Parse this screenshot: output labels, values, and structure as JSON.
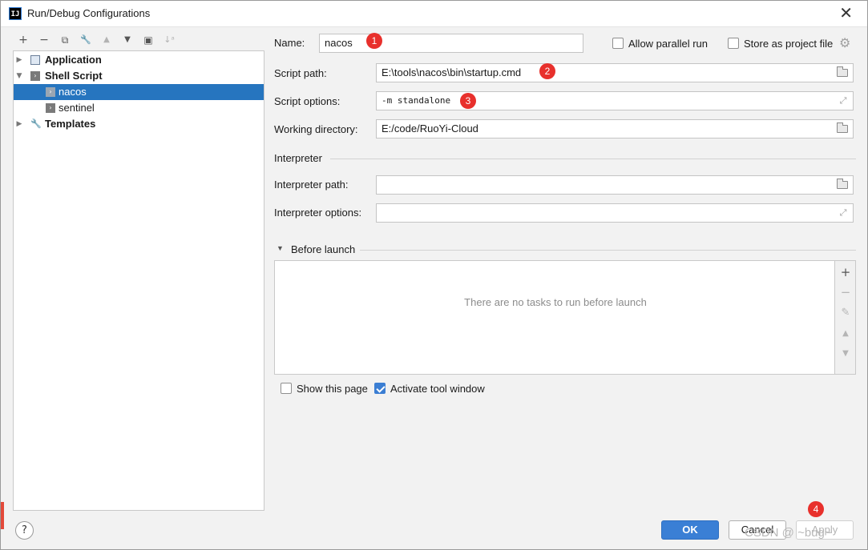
{
  "window": {
    "title": "Run/Debug Configurations",
    "app_icon": "IJ",
    "close": "✕"
  },
  "toolbar": {
    "add": "+",
    "remove": "−",
    "copy": "⧉",
    "edit": "🔧",
    "up": "▲",
    "down": "▼",
    "folder": "▣",
    "sort": "↓ᵃ"
  },
  "tree": {
    "items": [
      {
        "label": "Application",
        "icon": "application-icon"
      },
      {
        "label": "Shell Script",
        "icon": "shell-script-icon"
      },
      {
        "label": "nacos",
        "icon": "shell-script-icon",
        "selected": true
      },
      {
        "label": "sentinel",
        "icon": "shell-script-icon"
      },
      {
        "label": "Templates",
        "icon": "wrench-icon"
      }
    ]
  },
  "form": {
    "name_label": "Name:",
    "name_value": "nacos",
    "allow_parallel": "Allow parallel run",
    "store_project": "Store as project file",
    "script_path_label": "Script path:",
    "script_path_value": "E:\\tools\\nacos\\bin\\startup.cmd",
    "script_options_label": "Script options:",
    "script_options_value": "-m standalone",
    "working_dir_label": "Working directory:",
    "working_dir_value": "E:/code/RuoYi-Cloud",
    "interpreter_section": "Interpreter",
    "interpreter_path_label": "Interpreter path:",
    "interpreter_path_value": "",
    "interpreter_options_label": "Interpreter options:",
    "interpreter_options_value": ""
  },
  "before_launch": {
    "title": "Before launch",
    "empty": "There are no tasks to run before launch",
    "side": [
      "+",
      "−",
      "✎",
      "▲",
      "▼"
    ]
  },
  "checks": {
    "show_page": "Show this page",
    "show_page_checked": false,
    "activate_window": "Activate tool window",
    "activate_window_checked": true
  },
  "badges": [
    "1",
    "2",
    "3",
    "4"
  ],
  "footer": {
    "help": "?",
    "ok": "OK",
    "cancel": "Cancel",
    "apply": "Apply",
    "watermark": "CSDN @ ~bug~"
  },
  "colors": {
    "accent": "#2675bf",
    "badge": "#e8302c"
  }
}
